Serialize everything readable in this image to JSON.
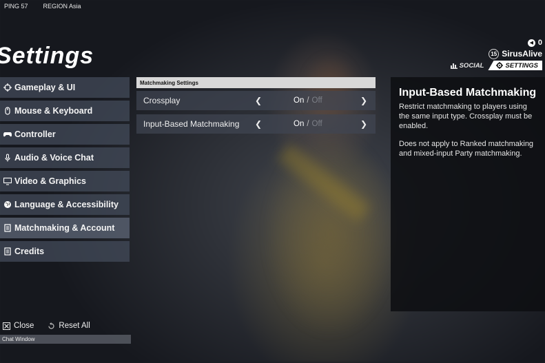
{
  "status": {
    "ping": "PING 57",
    "region": "REGION Asia"
  },
  "page": {
    "title": "Settings"
  },
  "user": {
    "currency_amount": "0",
    "level": "15",
    "name": "SirusAlive",
    "tabs": {
      "social": "SOCIAL",
      "settings": "SETTINGS"
    }
  },
  "sidebar": {
    "items": [
      {
        "label": "Gameplay & UI",
        "icon": "crosshair-icon"
      },
      {
        "label": "Mouse & Keyboard",
        "icon": "mouse-icon"
      },
      {
        "label": "Controller",
        "icon": "gamepad-icon"
      },
      {
        "label": "Audio & Voice Chat",
        "icon": "microphone-icon"
      },
      {
        "label": "Video & Graphics",
        "icon": "monitor-icon"
      },
      {
        "label": "Language & Accessibility",
        "icon": "globe-icon"
      },
      {
        "label": "Matchmaking & Account",
        "icon": "document-icon"
      },
      {
        "label": "Credits",
        "icon": "document-icon"
      }
    ]
  },
  "panel": {
    "header": "Matchmaking Settings",
    "rows": [
      {
        "label": "Crossplay",
        "on": "On",
        "sep": "/",
        "off": "Off"
      },
      {
        "label": "Input-Based Matchmaking",
        "on": "On",
        "sep": "/",
        "off": "Off"
      }
    ]
  },
  "description": {
    "title": "Input-Based Matchmaking",
    "paragraph1": "Restrict matchmaking to players using the same input type. Crossplay must be enabled.",
    "paragraph2": "Does not apply to Ranked matchmaking and mixed-input Party matchmaking."
  },
  "actions": {
    "close": "Close",
    "reset_all": "Reset All"
  },
  "chat": {
    "label": "Chat Window"
  },
  "colors": {
    "panel_header_bg": "#d8d8d8",
    "off_text": "#7d8088",
    "active_tab_bg": "#ffffff"
  }
}
